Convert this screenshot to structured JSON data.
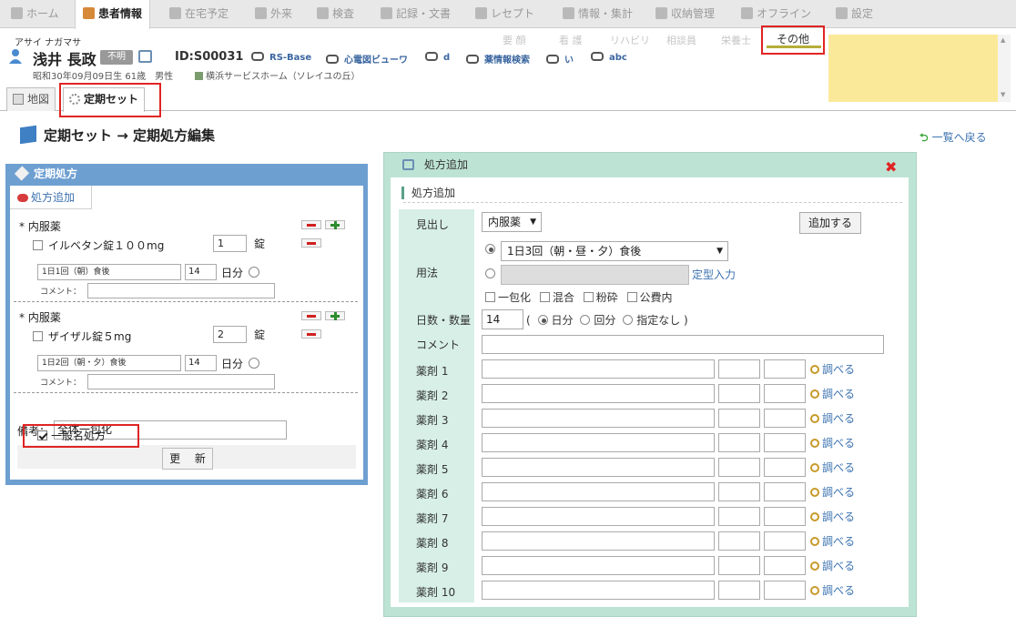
{
  "nav": {
    "items": [
      {
        "label": "ホーム",
        "active": false
      },
      {
        "label": "患者情報",
        "active": true
      },
      {
        "label": "在宅予定",
        "active": false
      },
      {
        "label": "外来",
        "active": false
      },
      {
        "label": "検査",
        "active": false
      },
      {
        "label": "記録・文書",
        "active": false
      },
      {
        "label": "レセプト",
        "active": false
      },
      {
        "label": "情報・集計",
        "active": false
      },
      {
        "label": "収納管理",
        "active": false
      },
      {
        "label": "オフライン",
        "active": false
      },
      {
        "label": "設定",
        "active": false
      }
    ]
  },
  "patient": {
    "kana": "アサイ ナガマサ",
    "name": "浅井 長政",
    "badge": "不明",
    "id": "ID:S00031",
    "links": [
      "RS-Base",
      "心電図ビューワ",
      "d",
      "薬情報検索",
      "い",
      "abc"
    ],
    "dob": "昭和30年09月09日生 61歳　男性",
    "facility": "横浜サービスホーム（ソレイユの丘）"
  },
  "subtabs": [
    "要 顔",
    "看 護",
    "リハビリ",
    "相談員",
    "栄養士"
  ],
  "other_tab": "その他",
  "page_tabs": {
    "map": "地図",
    "teiki": "定期セット"
  },
  "page_title": "定期セット → 定期処方編集",
  "back_link": "一覧へ戻る",
  "left_panel": {
    "title": "定期処方",
    "add_rx": "処方追加",
    "rx": [
      {
        "type": "* 内服薬",
        "drug": "イルベタン錠１００mg",
        "qty": "1",
        "unit": "錠",
        "usage": "1日1回（朝）食後",
        "days": "14",
        "days_unit": "日分",
        "comment_label": "コメント："
      },
      {
        "type": "* 内服薬",
        "drug": "ザイザル錠５mg",
        "qty": "2",
        "unit": "錠",
        "usage": "1日2回（朝・夕）食後",
        "days": "14",
        "days_unit": "日分",
        "comment_label": "コメント："
      }
    ],
    "biko_label": "備考：",
    "biko_value": "全体一包化",
    "ippan_label": "一般名処方",
    "ippan_checked": true,
    "update_btn": "更 新"
  },
  "right_panel": {
    "title": "処方追加",
    "section": "処方追加",
    "midashi_label": "見出し",
    "midashi_value": "内服薬",
    "add_btn": "追加する",
    "yoho_label": "用法",
    "yoho_value": "1日3回（朝・昼・夕）食後",
    "fixed_link": "定型入力",
    "options": [
      "一包化",
      "混合",
      "粉砕",
      "公費内"
    ],
    "days_label": "日数・数量",
    "days_value": "14",
    "days_units": [
      "日分",
      "回分",
      "指定なし"
    ],
    "comment_label": "コメント",
    "drug_labels": [
      "薬剤 1",
      "薬剤 2",
      "薬剤 3",
      "薬剤 4",
      "薬剤 5",
      "薬剤 6",
      "薬剤 7",
      "薬剤 8",
      "薬剤 9",
      "薬剤 10"
    ],
    "lookup_label": "調べる"
  }
}
